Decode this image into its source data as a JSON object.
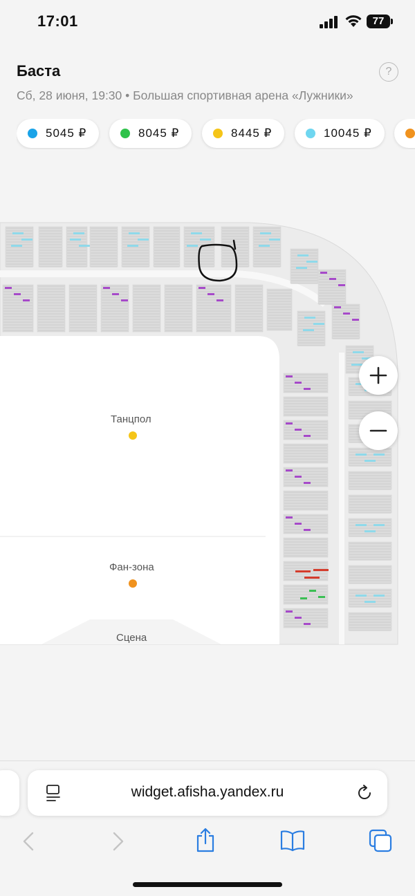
{
  "status_bar": {
    "time": "17:01",
    "battery": "77"
  },
  "event": {
    "title": "Баста",
    "subtitle": "Сб, 28 июня, 19:30  •  Большая спортивная арена «Лужники»",
    "help_symbol": "?"
  },
  "price_chips": [
    {
      "label": "5045 ₽",
      "color": "#1aa3e8"
    },
    {
      "label": "8045 ₽",
      "color": "#2ec24a"
    },
    {
      "label": "8445 ₽",
      "color": "#f5c518"
    },
    {
      "label": "10045 ₽",
      "color": "#6fd6f0"
    },
    {
      "label": "",
      "color": "#f0921e"
    }
  ],
  "map": {
    "zones": [
      {
        "label": "Танцпол",
        "color": "#f5c518"
      },
      {
        "label": "Фан-зона",
        "color": "#f0921e"
      },
      {
        "label": "Сцена",
        "color": ""
      }
    ],
    "zoom_in_icon": "plus-icon",
    "zoom_out_icon": "minus-icon",
    "available_colors": [
      "#a64ac9",
      "#8fd9ea",
      "#d43c2c",
      "#3cbf55"
    ]
  },
  "browser": {
    "url": "widget.afisha.yandex.ru",
    "icons": [
      "reader-icon",
      "reload-icon",
      "back-icon",
      "forward-icon",
      "share-icon",
      "bookmarks-icon",
      "tabs-icon"
    ]
  }
}
